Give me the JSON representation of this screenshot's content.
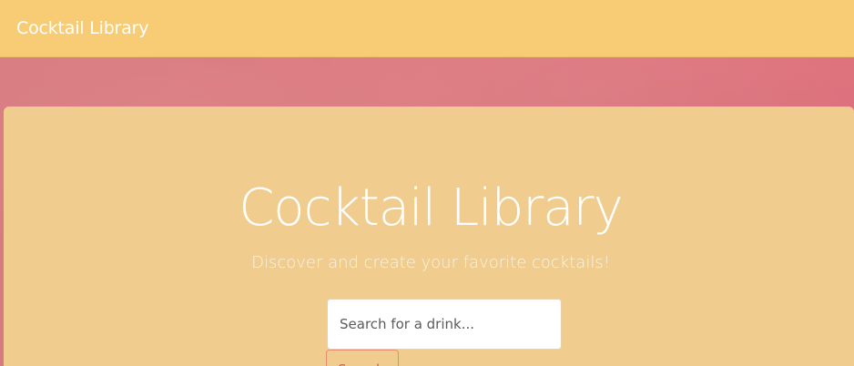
{
  "navbar": {
    "brand": "Cocktail Library"
  },
  "hero": {
    "title": "Cocktail Library",
    "subtitle": "Discover and create your favorite cocktails!"
  },
  "search": {
    "placeholder": "Search for a drink...",
    "value": "",
    "button_label": "Search"
  },
  "colors": {
    "navbar": "#f7cc75",
    "background": "#dc7a80",
    "jumbotron": "#f0cd8e",
    "button_border": "#e88b6f"
  }
}
